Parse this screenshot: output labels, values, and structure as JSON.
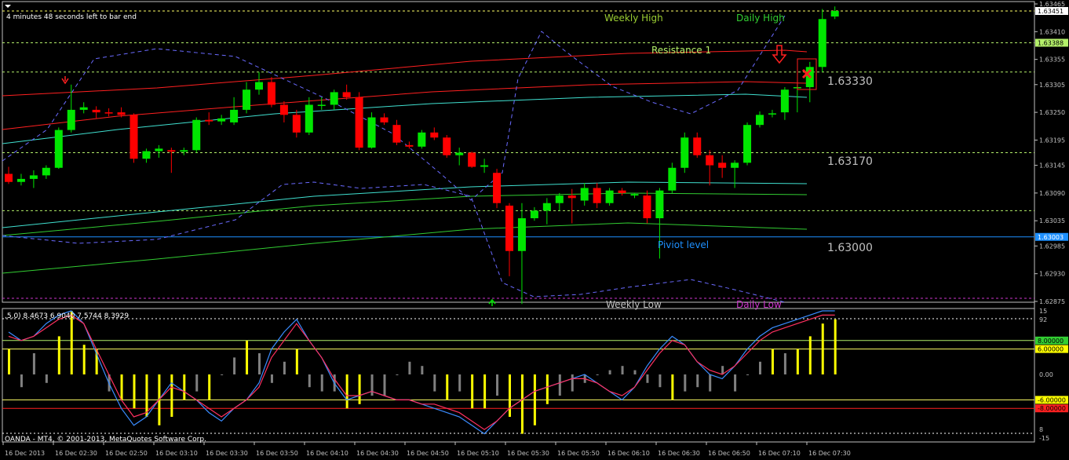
{
  "status": {
    "bar_timer": "4 minutes 48 seconds left to bar end",
    "copyright": "OANDA - MT4, © 2001-2013, MetaQuotes Software Corp."
  },
  "labels": {
    "weekly_high": "Weekly High",
    "daily_high": "Daily High",
    "resistance": "Resistance 1",
    "pivot": "Piviot level",
    "weekly_low": "Weekly Low",
    "daily_low": "Daily Low"
  },
  "round_levels": [
    "1.63330",
    "1.63170",
    "1.63000"
  ],
  "price_axis": {
    "ticks": [
      "1.63465",
      "1.63410",
      "1.63355",
      "1.63305",
      "1.63250",
      "1.63195",
      "1.63145",
      "1.63090",
      "1.63035",
      "1.62985",
      "1.62930",
      "1.62875"
    ],
    "marker_current": "1.63451",
    "marker_resistance": "1.63388",
    "marker_pivot": "1.63003"
  },
  "indicator": {
    "header": ",5,0) 8.4673 6.9040 7.5744 8.3929",
    "ticks": [
      "15",
      "92",
      "0.00",
      "8",
      "-15"
    ],
    "marker_upper_green": "8.00000",
    "marker_upper_yellow": "6.00000",
    "marker_lower_yellow": "-6.00000",
    "marker_lower_red": "-8.00000"
  },
  "time_axis": [
    "16 Dec 2013",
    "16 Dec 02:30",
    "16 Dec 02:50",
    "16 Dec 03:10",
    "16 Dec 03:30",
    "16 Dec 03:50",
    "16 Dec 04:10",
    "16 Dec 04:30",
    "16 Dec 04:50",
    "16 Dec 05:10",
    "16 Dec 05:30",
    "16 Dec 05:50",
    "16 Dec 06:10",
    "16 Dec 06:30",
    "16 Dec 06:50",
    "16 Dec 07:10",
    "16 Dec 07:30"
  ],
  "colors": {
    "bull": "#00e600",
    "bear": "#ff0000",
    "grid_green": "#b4f06a",
    "pivot_blue": "#1e90ff",
    "weekly_label": "#9acd32",
    "daily_label": "#32cd32",
    "magenta": "#cc33cc"
  },
  "candles": [
    [
      1.63128,
      1.63142,
      1.63108,
      1.63112
    ],
    [
      1.63112,
      1.63128,
      1.63105,
      1.63118
    ],
    [
      1.63118,
      1.63135,
      1.631,
      1.63125
    ],
    [
      1.63125,
      1.63145,
      1.63118,
      1.6314
    ],
    [
      1.6314,
      1.6322,
      1.63138,
      1.63215
    ],
    [
      1.63215,
      1.63305,
      1.6321,
      1.63255
    ],
    [
      1.63255,
      1.6327,
      1.63248,
      1.6326
    ],
    [
      1.63255,
      1.63262,
      1.63238,
      1.6325
    ],
    [
      1.6325,
      1.63258,
      1.63242,
      1.63248
    ],
    [
      1.6325,
      1.6326,
      1.6324,
      1.63245
    ],
    [
      1.63245,
      1.63248,
      1.6315,
      1.63158
    ],
    [
      1.63158,
      1.63178,
      1.6315,
      1.63173
    ],
    [
      1.63173,
      1.63185,
      1.6316,
      1.63178
    ],
    [
      1.63175,
      1.6318,
      1.6313,
      1.63172
    ],
    [
      1.63172,
      1.6318,
      1.63165,
      1.63175
    ],
    [
      1.63175,
      1.6324,
      1.6317,
      1.63235
    ],
    [
      1.63235,
      1.6325,
      1.63225,
      1.63232
    ],
    [
      1.63232,
      1.63245,
      1.63225,
      1.63238
    ],
    [
      1.6323,
      1.6328,
      1.63225,
      1.63255
    ],
    [
      1.63255,
      1.6331,
      1.63248,
      1.63295
    ],
    [
      1.63295,
      1.6333,
      1.63285,
      1.6331
    ],
    [
      1.6331,
      1.6332,
      1.6326,
      1.63265
    ],
    [
      1.63265,
      1.63272,
      1.6323,
      1.63245
    ],
    [
      1.63245,
      1.63255,
      1.632,
      1.6321
    ],
    [
      1.6321,
      1.6328,
      1.63205,
      1.63265
    ],
    [
      1.63265,
      1.6328,
      1.63255,
      1.63265
    ],
    [
      1.63265,
      1.63295,
      1.63255,
      1.6329
    ],
    [
      1.6329,
      1.63305,
      1.63275,
      1.6328
    ],
    [
      1.6328,
      1.6329,
      1.63175,
      1.6318
    ],
    [
      1.6318,
      1.6325,
      1.63178,
      1.6324
    ],
    [
      1.6324,
      1.63248,
      1.63225,
      1.6323
    ],
    [
      1.63225,
      1.63235,
      1.63185,
      1.6319
    ],
    [
      1.63185,
      1.63192,
      1.63178,
      1.63182
    ],
    [
      1.63182,
      1.63215,
      1.63178,
      1.6321
    ],
    [
      1.6321,
      1.6322,
      1.63195,
      1.632
    ],
    [
      1.632,
      1.63205,
      1.6316,
      1.63165
    ],
    [
      1.63165,
      1.6318,
      1.63145,
      1.6317
    ],
    [
      1.6317,
      1.63172,
      1.6314,
      1.63142
    ],
    [
      1.63142,
      1.63158,
      1.6313,
      1.63145
    ],
    [
      1.6313,
      1.63138,
      1.6306,
      1.6307
    ],
    [
      1.63065,
      1.6307,
      1.62925,
      1.62975
    ],
    [
      1.62975,
      1.6307,
      1.6287,
      1.6304
    ],
    [
      1.6304,
      1.63062,
      1.63035,
      1.63055
    ],
    [
      1.63055,
      1.6308,
      1.63028,
      1.6307
    ],
    [
      1.6307,
      1.6309,
      1.63055,
      1.63085
    ],
    [
      1.63085,
      1.63098,
      1.6303,
      1.6308
    ],
    [
      1.63075,
      1.6311,
      1.63065,
      1.631
    ],
    [
      1.631,
      1.6311,
      1.6306,
      1.6307
    ],
    [
      1.6307,
      1.631,
      1.63065,
      1.63095
    ],
    [
      1.63095,
      1.631,
      1.63085,
      1.6309
    ],
    [
      1.63085,
      1.6309,
      1.6308,
      1.63088
    ],
    [
      1.63085,
      1.63095,
      1.6303,
      1.6304
    ],
    [
      1.6304,
      1.631,
      1.6296,
      1.63095
    ],
    [
      1.63095,
      1.6315,
      1.6309,
      1.6314
    ],
    [
      1.6314,
      1.6321,
      1.6313,
      1.632
    ],
    [
      1.632,
      1.6321,
      1.6316,
      1.63165
    ],
    [
      1.63165,
      1.63175,
      1.63105,
      1.63145
    ],
    [
      1.6315,
      1.63165,
      1.6312,
      1.6314
    ],
    [
      1.6314,
      1.63155,
      1.631,
      1.6315
    ],
    [
      1.6315,
      1.6323,
      1.63145,
      1.63225
    ],
    [
      1.63225,
      1.63252,
      1.6322,
      1.63245
    ],
    [
      1.63248,
      1.63255,
      1.6324,
      1.63248
    ],
    [
      1.6325,
      1.633,
      1.63235,
      1.63295
    ],
    [
      1.633,
      1.63305,
      1.6325,
      1.633
    ],
    [
      1.633,
      1.6335,
      1.6327,
      1.6334
    ],
    [
      1.6334,
      1.63455,
      1.6333,
      1.63435
    ],
    [
      1.6344,
      1.6346,
      1.63435,
      1.63451
    ]
  ],
  "osc_bars": [
    6,
    -3,
    5,
    -2,
    9,
    15,
    7,
    6,
    -4,
    -6,
    -8,
    -10,
    -12,
    -10,
    -6,
    -4,
    -6,
    0,
    4,
    8,
    5,
    -2,
    3,
    6,
    -3,
    -4,
    -4,
    -8,
    -7,
    -5,
    -5,
    0,
    3,
    2,
    -4,
    -6,
    -4,
    -8,
    -8,
    -5,
    -10,
    -14,
    -12,
    -7,
    -5,
    -4,
    -2,
    0,
    1,
    2,
    1,
    -2,
    -3,
    -6,
    -4,
    -3,
    -4,
    2,
    -4,
    0,
    3,
    6,
    5,
    6,
    9,
    12,
    13
  ],
  "osc_line_blue": [
    10,
    8,
    9,
    12,
    14,
    15,
    12,
    5,
    -2,
    -8,
    -12,
    -10,
    -6,
    -2,
    -4,
    -6,
    -9,
    -11,
    -8,
    -6,
    -2,
    6,
    10,
    13,
    8,
    4,
    -2,
    -6,
    -5,
    -4,
    -5,
    -6,
    -6,
    -7,
    -8,
    -9,
    -10,
    -12,
    -14,
    -11,
    -8,
    -6,
    -4,
    -3,
    -2,
    -1,
    0,
    -2,
    -4,
    -6,
    -3,
    2,
    6,
    9,
    7,
    3,
    0,
    -1,
    2,
    6,
    9,
    11,
    12,
    13,
    14,
    15,
    15
  ],
  "osc_line_red": [
    9,
    8,
    9,
    11,
    13,
    14,
    12,
    6,
    0,
    -6,
    -10,
    -9,
    -6,
    -3,
    -4,
    -6,
    -8,
    -10,
    -8,
    -6,
    -3,
    4,
    8,
    12,
    8,
    4,
    -1,
    -5,
    -5,
    -4,
    -5,
    -6,
    -6,
    -7,
    -7,
    -8,
    -9,
    -11,
    -13,
    -11,
    -8,
    -6,
    -4,
    -3,
    -2,
    -1,
    -1,
    -2,
    -4,
    -5,
    -3,
    1,
    5,
    8,
    7,
    3,
    1,
    0,
    2,
    5,
    8,
    10,
    11,
    12,
    13,
    14,
    14
  ]
}
